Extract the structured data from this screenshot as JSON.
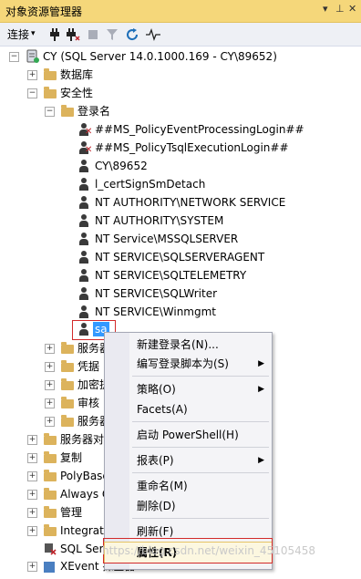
{
  "panel": {
    "title": "对象资源管理器"
  },
  "toolbar": {
    "connect_label": "连接",
    "dropdown_arrow": "▾"
  },
  "tree": {
    "server": "CY (SQL Server 14.0.1000.169 - CY\\89652)",
    "databases": "数据库",
    "security": "安全性",
    "logins": "登录名",
    "login_items": [
      "##MS_PolicyEventProcessingLogin##",
      "##MS_PolicyTsqlExecutionLogin##",
      "CY\\89652",
      "l_certSignSmDetach",
      "NT AUTHORITY\\NETWORK SERVICE",
      "NT AUTHORITY\\SYSTEM",
      "NT Service\\MSSQLSERVER",
      "NT SERVICE\\SQLSERVERAGENT",
      "NT SERVICE\\SQLTELEMETRY",
      "NT SERVICE\\SQLWriter",
      "NT SERVICE\\Winmgmt",
      "sa"
    ],
    "security_children": [
      "服务器",
      "凭据",
      "加密提",
      "审核",
      "服务器"
    ],
    "root_children": [
      "服务器对",
      "复制",
      "PolyBase",
      "Always O",
      "管理",
      "Integrat",
      "SQL Serv",
      "XEvent 探查器"
    ]
  },
  "context_menu": {
    "new_login": "新建登录名(N)...",
    "script_login": "编写登录脚本为(S)",
    "policies": "策略(O)",
    "facets": "Facets(A)",
    "powershell": "启动 PowerShell(H)",
    "reports": "报表(P)",
    "rename": "重命名(M)",
    "delete": "删除(D)",
    "refresh": "刷新(F)",
    "properties": "属性(R)"
  },
  "watermark": "https://blog.csdn.net/weixin_45105458"
}
